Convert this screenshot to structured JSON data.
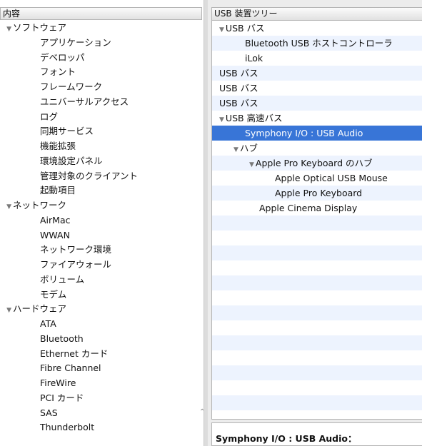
{
  "sidebar": {
    "header": "内容",
    "items": [
      {
        "level": 0,
        "label": "ソフトウェア",
        "expanded": true
      },
      {
        "level": 1,
        "label": "アプリケーション"
      },
      {
        "level": 1,
        "label": "デベロッパ"
      },
      {
        "level": 1,
        "label": "フォント"
      },
      {
        "level": 1,
        "label": "フレームワーク"
      },
      {
        "level": 1,
        "label": "ユニバーサルアクセス"
      },
      {
        "level": 1,
        "label": "ログ"
      },
      {
        "level": 1,
        "label": "同期サービス"
      },
      {
        "level": 1,
        "label": "機能拡張"
      },
      {
        "level": 1,
        "label": "環境設定パネル"
      },
      {
        "level": 1,
        "label": "管理対象のクライアント"
      },
      {
        "level": 1,
        "label": "起動項目"
      },
      {
        "level": 0,
        "label": "ネットワーク",
        "expanded": true
      },
      {
        "level": 1,
        "label": "AirMac"
      },
      {
        "level": 1,
        "label": "WWAN"
      },
      {
        "level": 1,
        "label": "ネットワーク環境"
      },
      {
        "level": 1,
        "label": "ファイアウォール"
      },
      {
        "level": 1,
        "label": "ボリューム"
      },
      {
        "level": 1,
        "label": "モデム"
      },
      {
        "level": 0,
        "label": "ハードウェア",
        "expanded": true
      },
      {
        "level": 1,
        "label": "ATA"
      },
      {
        "level": 1,
        "label": "Bluetooth"
      },
      {
        "level": 1,
        "label": "Ethernet カード"
      },
      {
        "level": 1,
        "label": "Fibre Channel"
      },
      {
        "level": 1,
        "label": "FireWire"
      },
      {
        "level": 1,
        "label": "PCI カード"
      },
      {
        "level": 1,
        "label": "SAS"
      },
      {
        "level": 1,
        "label": "Thunderbolt"
      }
    ]
  },
  "usb_tree": {
    "header": "USB 装置ツリー",
    "rows": [
      {
        "indent": 0,
        "label": "USB バス",
        "toggle": true
      },
      {
        "indent": 2,
        "label": "Bluetooth USB ホストコントローラ"
      },
      {
        "indent": 2,
        "label": "iLok"
      },
      {
        "indent": 0,
        "label": "USB バス"
      },
      {
        "indent": 0,
        "label": "USB バス"
      },
      {
        "indent": 0,
        "label": "USB バス"
      },
      {
        "indent": 0,
        "label": "USB 高速バス",
        "toggle": true
      },
      {
        "indent": 2,
        "label": "Symphony I/O : USB Audio",
        "selected": true
      },
      {
        "indent": 1,
        "label": "ハブ",
        "toggle": true
      },
      {
        "indent": 2,
        "label": "Apple Pro Keyboard のハブ",
        "toggle": true
      },
      {
        "indent": 4,
        "label": "Apple Optical USB Mouse"
      },
      {
        "indent": 4,
        "label": "Apple Pro Keyboard"
      },
      {
        "indent": 3,
        "label": "Apple Cinema Display"
      },
      {
        "indent": 0,
        "label": ""
      },
      {
        "indent": 0,
        "label": ""
      },
      {
        "indent": 0,
        "label": ""
      },
      {
        "indent": 0,
        "label": ""
      },
      {
        "indent": 0,
        "label": ""
      },
      {
        "indent": 0,
        "label": ""
      },
      {
        "indent": 0,
        "label": ""
      },
      {
        "indent": 0,
        "label": ""
      },
      {
        "indent": 0,
        "label": ""
      },
      {
        "indent": 0,
        "label": ""
      },
      {
        "indent": 0,
        "label": ""
      },
      {
        "indent": 0,
        "label": ""
      },
      {
        "indent": 0,
        "label": ""
      },
      {
        "indent": 0,
        "label": ""
      }
    ]
  },
  "detail": {
    "title": "Symphony I/O : USB Audio："
  },
  "colors": {
    "selection": "#3875d7",
    "stripe": "#edf3fe"
  }
}
